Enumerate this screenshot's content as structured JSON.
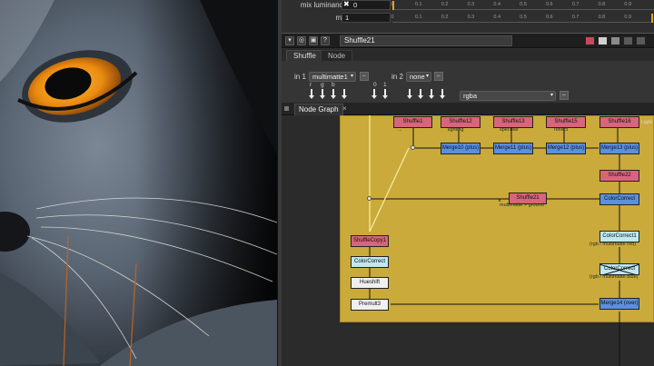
{
  "app": {
    "mix_rows": [
      {
        "label": "mix luminance",
        "value": "0",
        "toggle_mark": "✖"
      },
      {
        "label": "mix",
        "value": "1"
      }
    ],
    "slider_ticks": [
      "0",
      "0.1",
      "0.2",
      "0.3",
      "0.4",
      "0.5",
      "0.6",
      "0.7",
      "0.8",
      "0.9"
    ],
    "node_name": "Shuffle21",
    "panel_tabs": [
      "Shuffle",
      "Node"
    ],
    "in1_label": "in 1",
    "in1_value": "multimatte1",
    "in2_label": "in 2",
    "in2_value": "none",
    "channel_letters_left": [
      "r",
      "g",
      "b"
    ],
    "channel_letters_right": [
      "0",
      "1"
    ],
    "output_value": "rgba",
    "graph_tab": "Node Graph",
    "graph_tab_close": "×"
  },
  "graph": {
    "top_nodes": [
      {
        "label": "Shuffle1",
        "sub": "..."
      },
      {
        "label": "Shuffle12",
        "sub": "lighting"
      },
      {
        "label": "Shuffle13",
        "sub": "specular"
      },
      {
        "label": "Shuffle15",
        "sub": "reflect"
      },
      {
        "label": "Shuffle16",
        "sub": ""
      }
    ],
    "top_right_text": "Light",
    "merge_nodes": [
      "Merge10 (plus)",
      "Merge11 (plus)",
      "Merge12 (plus)",
      "Merge13 (plus)"
    ],
    "shuffle22": "Shuffle22",
    "shuffle21": "Shuffle21",
    "shuffle21_sub": "multimatte > ground",
    "cc_right": [
      "ColorCorrect",
      "ColorCorrect1",
      "ColorCorrect"
    ],
    "cc_right_sub": [
      "(rgb / multimatte red)",
      "(rgb / multimatte blue)"
    ],
    "merge_final": "Merge14 (over)",
    "left_nodes": [
      "ShuffleCopy1",
      "ColorCorrect",
      "Hueshift",
      "Premult3"
    ]
  },
  "colors": {
    "backdrop": "#c9aa3a",
    "shuffle_node": "#d8657a",
    "merge_node": "#5b8fe0",
    "accent_handle": "#e8a020"
  }
}
